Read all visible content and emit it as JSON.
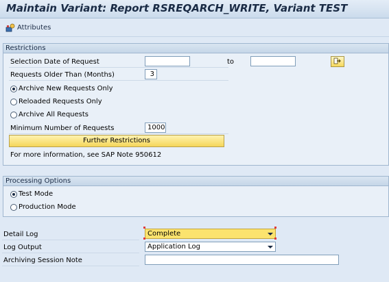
{
  "window": {
    "title": "Maintain Variant: Report RSREQARCH_WRITE, Variant TEST"
  },
  "toolbar": {
    "attributes_label": "Attributes"
  },
  "restrictions": {
    "group_title": "Restrictions",
    "selection_date_label": "Selection Date of Request",
    "selection_date_from": "",
    "to_label": "to",
    "selection_date_to": "",
    "older_than_label": "Requests Older Than (Months)",
    "older_than_value": "3",
    "radio_new_label": "Archive New Requests Only",
    "radio_reloaded_label": "Reloaded Requests Only",
    "radio_all_label": "Archive All Requests",
    "selected_radio": "new",
    "min_requests_label": "Minimum Number of Requests",
    "min_requests_value": "1000",
    "further_button_label": "Further Restrictions",
    "info_text": "For more information, see SAP Note 950612"
  },
  "processing": {
    "group_title": "Processing Options",
    "test_mode_label": "Test Mode",
    "production_mode_label": "Production Mode",
    "selected_mode": "test"
  },
  "detail_log": {
    "label": "Detail Log",
    "value": "Complete"
  },
  "log_output": {
    "label": "Log Output",
    "value": "Application Log"
  },
  "session_note": {
    "label": "Archiving Session Note",
    "value": ""
  },
  "icons": {
    "attributes": "attributes-icon",
    "multiple_selection": "multiple-selection-arrow-icon"
  },
  "colors": {
    "highlight": "#fbe36e",
    "button": "#f5d65a",
    "background": "#dfe9f5"
  }
}
